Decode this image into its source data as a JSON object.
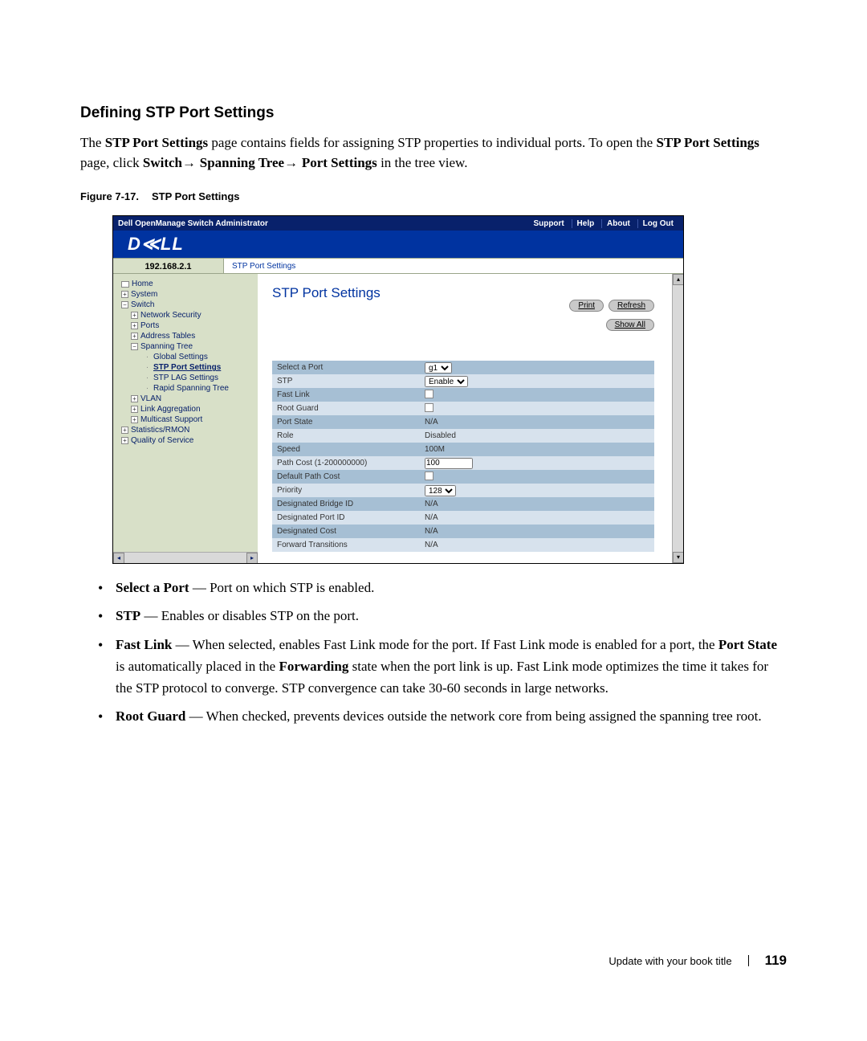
{
  "heading": "Defining STP Port Settings",
  "intro": {
    "p1a": "The ",
    "p1b": "STP Port Settings",
    "p1c": " page contains fields for assigning STP properties to individual ports. To open the ",
    "p1d": "STP Port Settings",
    "p1e": " page, click ",
    "p1f": "Switch",
    "p1g": "Spanning Tree",
    "p1h": "Port Settings",
    "p1i": " in the tree view."
  },
  "figcap_num": "Figure 7-17.",
  "figcap_txt": "STP Port Settings",
  "screenshot": {
    "titlebar": "Dell OpenManage Switch Administrator",
    "nav": {
      "support": "Support",
      "help": "Help",
      "about": "About",
      "logout": "Log Out"
    },
    "logo": "D≪LL",
    "ip": "192.168.2.1",
    "breadcrumb": "STP Port Settings",
    "tree": {
      "home": "Home",
      "system": "System",
      "switch": "Switch",
      "netsec": "Network Security",
      "ports": "Ports",
      "addr": "Address Tables",
      "span": "Spanning Tree",
      "glob": "Global Settings",
      "stpport": "STP Port Settings",
      "stplag": "STP LAG Settings",
      "rapid": "Rapid Spanning Tree",
      "vlan": "VLAN",
      "linkagg": "Link Aggregation",
      "mcast": "Multicast Support",
      "stats": "Statistics/RMON",
      "qos": "Quality of Service"
    },
    "panel_title": "STP Port Settings",
    "buttons": {
      "print": "Print",
      "refresh": "Refresh",
      "showall": "Show All"
    },
    "rows": [
      {
        "label": "Select a Port",
        "type": "select",
        "value": "g1"
      },
      {
        "label": "STP",
        "type": "select",
        "value": "Enable"
      },
      {
        "label": "Fast Link",
        "type": "check",
        "value": ""
      },
      {
        "label": "Root Guard",
        "type": "check",
        "value": ""
      },
      {
        "label": "Port State",
        "type": "text",
        "value": "N/A"
      },
      {
        "label": "Role",
        "type": "text",
        "value": "Disabled"
      },
      {
        "label": "Speed",
        "type": "text",
        "value": "100M"
      },
      {
        "label": "Path Cost (1-200000000)",
        "type": "input",
        "value": "100"
      },
      {
        "label": "Default Path Cost",
        "type": "check",
        "value": ""
      },
      {
        "label": "Priority",
        "type": "select",
        "value": "128"
      },
      {
        "label": "Designated Bridge ID",
        "type": "text",
        "value": "N/A"
      },
      {
        "label": "Designated Port ID",
        "type": "text",
        "value": "N/A"
      },
      {
        "label": "Designated Cost",
        "type": "text",
        "value": "N/A"
      },
      {
        "label": "Forward Transitions",
        "type": "text",
        "value": "N/A"
      }
    ]
  },
  "bullets": {
    "b1_term": "Select a Port",
    "b1_desc": " — Port on which STP is enabled.",
    "b2_term": "STP",
    "b2_desc": " — Enables or disables STP on the port.",
    "b3_term": "Fast Link",
    "b3_desc_a": " — When selected, enables Fast Link mode for the port. If Fast Link mode is enabled for a port, the ",
    "b3_desc_b": "Port State",
    "b3_desc_c": " is automatically placed in the ",
    "b3_desc_d": "Forwarding",
    "b3_desc_e": " state when the port link is up. Fast Link mode optimizes the time it takes for the STP protocol to converge. STP convergence can take 30-60 seconds in large networks.",
    "b4_term": "Root Guard",
    "b4_desc": " — When checked, prevents devices outside the network core from being assigned the spanning tree root."
  },
  "footer": {
    "booktitle": "Update with your book title",
    "pagenum": "119"
  }
}
